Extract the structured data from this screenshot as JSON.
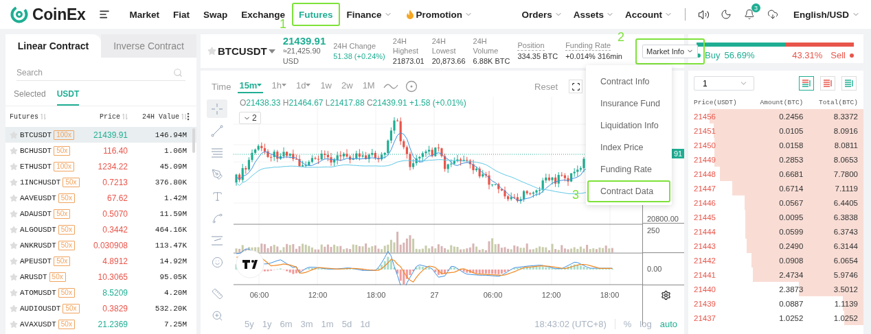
{
  "header": {
    "logo": "CoinEx",
    "nav": [
      {
        "label": "Market",
        "dropdown": false,
        "selected": false
      },
      {
        "label": "Fiat",
        "dropdown": false,
        "selected": false
      },
      {
        "label": "Swap",
        "dropdown": false,
        "selected": false
      },
      {
        "label": "Exchange",
        "dropdown": false,
        "selected": false
      },
      {
        "label": "Futures",
        "dropdown": false,
        "selected": true,
        "callout": "1"
      },
      {
        "label": "Finance",
        "dropdown": true,
        "selected": false
      },
      {
        "label": "Promotion",
        "dropdown": true,
        "selected": false,
        "kind": "promo"
      }
    ],
    "account_nav": [
      {
        "label": "Orders",
        "dropdown": true
      },
      {
        "label": "Assets",
        "dropdown": true
      },
      {
        "label": "Account",
        "dropdown": true
      }
    ],
    "notifications": "3",
    "language": "English/USD"
  },
  "market_list": {
    "tabs": [
      {
        "label": "Linear Contract",
        "selected": true
      },
      {
        "label": "Inverse Contract",
        "selected": false
      }
    ],
    "search": {
      "placeholder": "Search"
    },
    "quote_tabs": [
      {
        "label": "Selected",
        "selected": false
      },
      {
        "label": "USDT",
        "selected": true
      }
    ],
    "columns": [
      "Futures",
      "Price",
      "24H Value"
    ],
    "rows": [
      {
        "name": "BTCUSDT",
        "leverage": "100x",
        "price": "21439.91",
        "color": "#1fae93",
        "value": "146.94M",
        "selected": true
      },
      {
        "name": "BCHUSDT",
        "leverage": "50x",
        "price": "116.40",
        "color": "#e8554a",
        "value": "1.06M",
        "selected": false
      },
      {
        "name": "ETHUSDT",
        "leverage": "100x",
        "price": "1234.22",
        "color": "#e8554a",
        "value": "45.09M",
        "selected": false
      },
      {
        "name": "1INCHUSDT",
        "leverage": "50x",
        "price": "0.7213",
        "color": "#e8554a",
        "value": "376.80K",
        "selected": false
      },
      {
        "name": "AAVEUSDT",
        "leverage": "50x",
        "price": "67.62",
        "color": "#e8554a",
        "value": "1.42M",
        "selected": false
      },
      {
        "name": "ADAUSDT",
        "leverage": "50x",
        "price": "0.5070",
        "color": "#e8554a",
        "value": "11.59M",
        "selected": false
      },
      {
        "name": "ALGOUSDT",
        "leverage": "50x",
        "price": "0.3442",
        "color": "#e8554a",
        "value": "464.16K",
        "selected": false
      },
      {
        "name": "ANKRUSDT",
        "leverage": "50x",
        "price": "0.030908",
        "color": "#e8554a",
        "value": "113.47K",
        "selected": false
      },
      {
        "name": "APEUSDT",
        "leverage": "50x",
        "price": "4.8912",
        "color": "#e8554a",
        "value": "14.92M",
        "selected": false
      },
      {
        "name": "ARUSDT",
        "leverage": "50x",
        "price": "10.3065",
        "color": "#e8554a",
        "value": "95.05K",
        "selected": false
      },
      {
        "name": "ATOMUSDT",
        "leverage": "50x",
        "price": "8.5209",
        "color": "#1fae93",
        "value": "4.20M",
        "selected": false
      },
      {
        "name": "AUDIOUSDT",
        "leverage": "50x",
        "price": "0.3829",
        "color": "#e8554a",
        "value": "532.20K",
        "selected": false
      },
      {
        "name": "AVAXUSDT",
        "leverage": "50x",
        "price": "21.2369",
        "color": "#1fae93",
        "value": "7.25M",
        "selected": false
      }
    ]
  },
  "ticker": {
    "symbol": "BTCUSDT",
    "price": "21439.91",
    "price_usd": "≈21,425.90",
    "usd_label": "USD",
    "stats": [
      {
        "label": "24H Change",
        "value": "51.38 (+0.24%)",
        "kind": "change"
      },
      {
        "label": "24H Highest",
        "value": "21873.01",
        "kind": "plain"
      },
      {
        "label": "24H Lowest",
        "value": "20,873.66",
        "kind": "plain"
      },
      {
        "label": "24H Volume",
        "value": "6.88K BTC",
        "kind": "plain"
      },
      {
        "label": "Position",
        "value": "334.35 BTC",
        "kind": "dashed"
      },
      {
        "label": "Funding Rate",
        "value": "+0.014% 316min",
        "kind": "dashed"
      }
    ],
    "market_info": {
      "label": "Market Info",
      "callout": "2"
    }
  },
  "market_info_menu": [
    {
      "label": "Contract Info"
    },
    {
      "label": "Insurance Fund"
    },
    {
      "label": "Liquidation Info"
    },
    {
      "label": "Index Price"
    },
    {
      "label": "Funding Rate"
    },
    {
      "label": "Contract Data",
      "callout": "3"
    }
  ],
  "chart": {
    "time_label": "Time",
    "intervals": [
      {
        "label": "15m",
        "dropdown": true,
        "selected": true
      },
      {
        "label": "1h",
        "dropdown": true,
        "selected": false
      },
      {
        "label": "1d",
        "dropdown": true,
        "selected": false
      },
      {
        "label": "1w",
        "dropdown": false,
        "selected": false
      },
      {
        "label": "2w",
        "dropdown": false,
        "selected": false
      },
      {
        "label": "1M",
        "dropdown": false,
        "selected": false
      }
    ],
    "reset": "Reset",
    "ohlc": [
      {
        "label": "O",
        "value": "21438.33"
      },
      {
        "label": "H",
        "value": "21464.67"
      },
      {
        "label": "L",
        "value": "21417.88"
      },
      {
        "label": "C",
        "value": "21439.91"
      }
    ],
    "change": "+1.58 (+0.01%)",
    "indicator_count": "2",
    "price_tag": "91",
    "price_axis_label": "20800.00",
    "volume_axis_label": "250",
    "macd_axis_label": "0.00",
    "time_labels": [
      "06:00",
      "12:00",
      "18:00",
      "27",
      "06:00",
      "12:00",
      "18:00"
    ],
    "ranges": [
      "5y",
      "1y",
      "6m",
      "3m",
      "1m",
      "5d",
      "1d"
    ],
    "clock": "18:43:02 (UTC+8)",
    "scale_options": [
      {
        "label": "%",
        "selected": false
      },
      {
        "label": "log",
        "selected": false
      },
      {
        "label": "auto",
        "selected": true
      }
    ]
  },
  "sentiment": {
    "buy_label": "Buy",
    "buy_pct": "56.69%",
    "sell_pct": "43.31%",
    "sell_label": "Sell",
    "level": 0.5669
  },
  "order_book": {
    "precision": "1",
    "views": [
      {
        "kind": "both",
        "selected": true
      },
      {
        "kind": "asks",
        "selected": false
      },
      {
        "kind": "bids",
        "selected": false
      }
    ],
    "columns": [
      "Price(USDT)",
      "Amount(BTC)",
      "Total(BTC)"
    ],
    "rows": [
      {
        "price": "21456",
        "amount": "0.2456",
        "total": "8.3372"
      },
      {
        "price": "21451",
        "amount": "0.0105",
        "total": "8.0916"
      },
      {
        "price": "21450",
        "amount": "0.0158",
        "total": "8.0811"
      },
      {
        "price": "21449",
        "amount": "0.2853",
        "total": "8.0653"
      },
      {
        "price": "21448",
        "amount": "0.6681",
        "total": "7.7800"
      },
      {
        "price": "21447",
        "amount": "0.6714",
        "total": "7.1119"
      },
      {
        "price": "21446",
        "amount": "0.0567",
        "total": "6.4405"
      },
      {
        "price": "21445",
        "amount": "0.0095",
        "total": "6.3838"
      },
      {
        "price": "21444",
        "amount": "0.0599",
        "total": "6.3743"
      },
      {
        "price": "21443",
        "amount": "0.2490",
        "total": "6.3144"
      },
      {
        "price": "21442",
        "amount": "0.0908",
        "total": "6.0654"
      },
      {
        "price": "21441",
        "amount": "2.4734",
        "total": "5.9746"
      },
      {
        "price": "21440",
        "amount": "2.3873",
        "total": "3.5012"
      },
      {
        "price": "21439",
        "amount": "0.0887",
        "total": "1.1139"
      },
      {
        "price": "21437",
        "amount": "1.0252",
        "total": "1.0252"
      }
    ]
  }
}
